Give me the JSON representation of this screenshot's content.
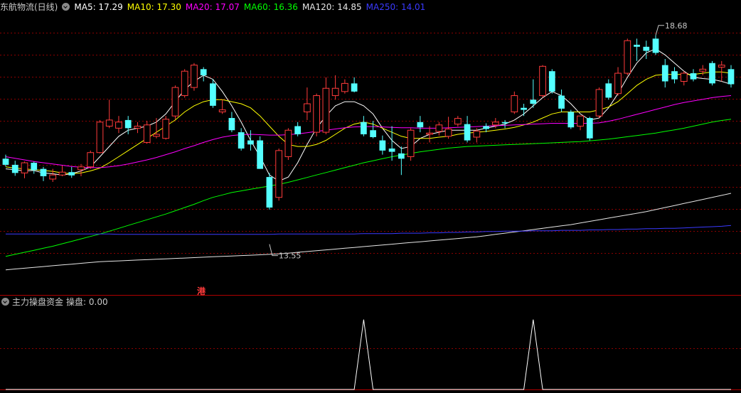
{
  "main_legend": {
    "title": "东航物流(日线)",
    "ma": [
      {
        "label": "MA5: 17.29",
        "color": "#ffffff"
      },
      {
        "label": "MA10: 17.30",
        "color": "#ffff00"
      },
      {
        "label": "MA20: 17.07",
        "color": "#ff00ff"
      },
      {
        "label": "MA60: 16.36",
        "color": "#00ff00"
      },
      {
        "label": "MA120: 14.85",
        "color": "#e6e6e6"
      },
      {
        "label": "MA250: 14.01",
        "color": "#3a3aff"
      }
    ]
  },
  "sub_legend": {
    "title": "主力操盘资金",
    "value_label": "操盘: 0.00"
  },
  "marker": {
    "text": "港",
    "color": "#ff3b3b"
  },
  "colors": {
    "up": "#ff3b3b",
    "down": "#54ffff",
    "grid": "#8b0000",
    "background": "#000000"
  },
  "chart_data": [
    {
      "type": "candlestick",
      "title": "东航物流(日线)",
      "ylim": [
        12.6,
        19.2
      ],
      "annotations": [
        {
          "label": "18.68",
          "type": "max_high",
          "value": 18.68
        },
        {
          "label": "13.55",
          "type": "min_low",
          "value": 13.55
        }
      ],
      "ohlc": [
        [
          15.65,
          15.75,
          15.46,
          15.5
        ],
        [
          15.5,
          15.6,
          15.23,
          15.3
        ],
        [
          15.3,
          15.58,
          15.17,
          15.55
        ],
        [
          15.55,
          15.58,
          15.28,
          15.37
        ],
        [
          15.4,
          15.45,
          15.1,
          15.22
        ],
        [
          15.15,
          15.4,
          15.08,
          15.25
        ],
        [
          15.25,
          15.48,
          15.22,
          15.32
        ],
        [
          15.32,
          15.45,
          15.18,
          15.24
        ],
        [
          15.38,
          15.52,
          15.22,
          15.45
        ],
        [
          15.45,
          15.85,
          15.4,
          15.8
        ],
        [
          15.8,
          16.6,
          15.78,
          16.55
        ],
        [
          16.45,
          17.1,
          16.4,
          16.6
        ],
        [
          16.4,
          16.7,
          16.28,
          16.55
        ],
        [
          16.6,
          16.7,
          16.25,
          16.4
        ],
        [
          16.4,
          16.55,
          16.28,
          16.45
        ],
        [
          16.05,
          16.58,
          16.02,
          16.48
        ],
        [
          16.2,
          16.65,
          16.15,
          16.25
        ],
        [
          16.15,
          16.7,
          16.12,
          16.62
        ],
        [
          16.7,
          17.45,
          16.62,
          17.4
        ],
        [
          17.2,
          17.85,
          17.15,
          17.8
        ],
        [
          17.4,
          18.0,
          17.32,
          17.95
        ],
        [
          17.85,
          17.9,
          17.55,
          17.7
        ],
        [
          17.5,
          17.6,
          16.9,
          16.95
        ],
        [
          16.8,
          17.1,
          16.75,
          16.85
        ],
        [
          16.65,
          16.8,
          16.3,
          16.35
        ],
        [
          16.3,
          16.4,
          15.85,
          15.9
        ],
        [
          16.1,
          16.35,
          15.85,
          16.0
        ],
        [
          16.1,
          16.2,
          15.4,
          15.4
        ],
        [
          15.2,
          15.3,
          14.4,
          14.45
        ],
        [
          14.7,
          15.9,
          14.62,
          15.85
        ],
        [
          15.7,
          16.4,
          15.62,
          16.35
        ],
        [
          16.45,
          16.55,
          16.2,
          16.25
        ],
        [
          16.8,
          17.4,
          16.6,
          17.0
        ],
        [
          16.3,
          17.25,
          16.2,
          17.2
        ],
        [
          16.3,
          17.65,
          16.25,
          17.38
        ],
        [
          17.2,
          17.7,
          17.1,
          17.38
        ],
        [
          17.3,
          17.6,
          17.25,
          17.5
        ],
        [
          17.5,
          17.65,
          17.28,
          17.3
        ],
        [
          16.55,
          16.7,
          16.2,
          16.25
        ],
        [
          16.35,
          16.58,
          16.15,
          16.18
        ],
        [
          16.1,
          16.22,
          15.75,
          15.85
        ],
        [
          15.9,
          16.45,
          15.6,
          15.82
        ],
        [
          15.78,
          15.95,
          15.25,
          15.65
        ],
        [
          15.7,
          16.4,
          15.6,
          16.35
        ],
        [
          16.55,
          16.7,
          16.3,
          16.42
        ],
        [
          16.25,
          16.45,
          16.05,
          16.28
        ],
        [
          16.32,
          16.55,
          16.22,
          16.48
        ],
        [
          16.2,
          16.68,
          16.14,
          16.38
        ],
        [
          16.5,
          16.7,
          16.44,
          16.64
        ],
        [
          16.5,
          16.7,
          16.05,
          16.1
        ],
        [
          16.18,
          16.4,
          16.05,
          16.33
        ],
        [
          16.45,
          16.52,
          16.3,
          16.38
        ],
        [
          16.48,
          16.65,
          16.4,
          16.55
        ],
        [
          16.55,
          16.6,
          16.4,
          16.52
        ],
        [
          16.8,
          17.3,
          16.75,
          17.2
        ],
        [
          16.9,
          17.0,
          16.7,
          16.85
        ],
        [
          17.1,
          17.6,
          16.9,
          17.0
        ],
        [
          17.2,
          17.95,
          17.15,
          17.92
        ],
        [
          17.8,
          17.85,
          17.25,
          17.3
        ],
        [
          17.2,
          17.35,
          16.8,
          16.88
        ],
        [
          16.8,
          16.85,
          16.38,
          16.42
        ],
        [
          16.45,
          16.7,
          16.35,
          16.7
        ],
        [
          16.65,
          16.68,
          16.1,
          16.15
        ],
        [
          16.7,
          17.4,
          16.65,
          17.35
        ],
        [
          17.5,
          17.6,
          17.1,
          17.15
        ],
        [
          17.25,
          17.9,
          17.2,
          17.75
        ],
        [
          17.75,
          18.6,
          17.7,
          18.55
        ],
        [
          18.45,
          18.6,
          18.05,
          18.4
        ],
        [
          18.4,
          18.55,
          18.1,
          18.3
        ],
        [
          18.6,
          18.68,
          18.2,
          18.25
        ],
        [
          17.95,
          18.1,
          17.4,
          17.55
        ],
        [
          17.8,
          17.9,
          17.5,
          17.6
        ],
        [
          17.55,
          17.8,
          17.45,
          17.75
        ],
        [
          17.75,
          17.85,
          17.55,
          17.6
        ],
        [
          17.8,
          17.95,
          17.7,
          17.85
        ],
        [
          18.0,
          18.05,
          17.45,
          17.5
        ],
        [
          17.9,
          18.05,
          17.55,
          17.95
        ],
        [
          17.85,
          17.95,
          17.4,
          17.48
        ]
      ],
      "series": [
        {
          "name": "MA5",
          "color": "#ffffff",
          "values": [
            15.4,
            15.38,
            15.35,
            15.36,
            15.3,
            15.28,
            15.25,
            15.28,
            15.35,
            15.45,
            15.7,
            15.95,
            16.2,
            16.35,
            16.4,
            16.45,
            16.55,
            16.75,
            17.05,
            17.35,
            17.55,
            17.7,
            17.6,
            17.3,
            16.95,
            16.55,
            16.1,
            15.7,
            15.25,
            15.1,
            15.2,
            15.55,
            16.0,
            16.4,
            16.7,
            16.95,
            17.05,
            17.05,
            16.95,
            16.75,
            16.4,
            16.1,
            15.9,
            15.95,
            16.15,
            16.25,
            16.3,
            16.35,
            16.35,
            16.35,
            16.35,
            16.4,
            16.45,
            16.5,
            16.6,
            16.75,
            16.95,
            17.15,
            17.3,
            17.2,
            17.0,
            16.75,
            16.6,
            16.65,
            16.9,
            17.25,
            17.65,
            18.0,
            18.25,
            18.35,
            18.2,
            18.0,
            17.8,
            17.65,
            17.62,
            17.6,
            17.55,
            17.48
          ]
        },
        {
          "name": "MA10",
          "color": "#ffff00",
          "values": [
            15.45,
            15.42,
            15.4,
            15.38,
            15.36,
            15.34,
            15.3,
            15.28,
            15.3,
            15.35,
            15.42,
            15.55,
            15.7,
            15.85,
            16.0,
            16.15,
            16.3,
            16.45,
            16.6,
            16.8,
            16.95,
            17.05,
            17.1,
            17.1,
            17.05,
            17.0,
            16.9,
            16.7,
            16.45,
            16.2,
            16.0,
            15.95,
            15.95,
            16.0,
            16.1,
            16.25,
            16.4,
            16.5,
            16.55,
            16.5,
            16.4,
            16.3,
            16.2,
            16.15,
            16.15,
            16.15,
            16.18,
            16.2,
            16.25,
            16.28,
            16.3,
            16.32,
            16.35,
            16.38,
            16.42,
            16.48,
            16.55,
            16.65,
            16.75,
            16.8,
            16.8,
            16.8,
            16.8,
            16.85,
            16.92,
            17.05,
            17.25,
            17.45,
            17.6,
            17.7,
            17.72,
            17.72,
            17.72,
            17.72,
            17.75,
            17.78,
            17.78,
            17.75
          ]
        },
        {
          "name": "MA20",
          "color": "#ff00ff",
          "values": [
            15.7,
            15.66,
            15.62,
            15.58,
            15.55,
            15.52,
            15.49,
            15.46,
            15.44,
            15.43,
            15.43,
            15.45,
            15.48,
            15.52,
            15.57,
            15.62,
            15.68,
            15.75,
            15.82,
            15.9,
            15.97,
            16.05,
            16.12,
            16.18,
            16.22,
            16.24,
            16.25,
            16.24,
            16.23,
            16.23,
            16.24,
            16.26,
            16.29,
            16.32,
            16.35,
            16.38,
            16.41,
            16.43,
            16.44,
            16.44,
            16.43,
            16.42,
            16.41,
            16.41,
            16.4,
            16.4,
            16.4,
            16.41,
            16.42,
            16.43,
            16.44,
            16.45,
            16.46,
            16.47,
            16.48,
            16.49,
            16.5,
            16.51,
            16.52,
            16.52,
            16.52,
            16.52,
            16.52,
            16.53,
            16.57,
            16.62,
            16.68,
            16.74,
            16.8,
            16.86,
            16.92,
            16.98,
            17.03,
            17.07,
            17.11,
            17.15,
            17.18,
            17.2
          ]
        },
        {
          "name": "MA60",
          "color": "#00ff00",
          "values": [
            13.25,
            13.3,
            13.35,
            13.4,
            13.45,
            13.5,
            13.56,
            13.62,
            13.68,
            13.74,
            13.8,
            13.87,
            13.94,
            14.01,
            14.08,
            14.15,
            14.22,
            14.29,
            14.37,
            14.45,
            14.53,
            14.62,
            14.7,
            14.76,
            14.82,
            14.86,
            14.9,
            14.94,
            14.98,
            15.02,
            15.07,
            15.13,
            15.19,
            15.25,
            15.31,
            15.37,
            15.43,
            15.49,
            15.55,
            15.6,
            15.65,
            15.7,
            15.74,
            15.78,
            15.82,
            15.85,
            15.88,
            15.91,
            15.93,
            15.95,
            15.96,
            15.97,
            15.98,
            15.99,
            16.0,
            16.01,
            16.02,
            16.03,
            16.04,
            16.05,
            16.06,
            16.07,
            16.09,
            16.11,
            16.13,
            16.16,
            16.19,
            16.22,
            16.25,
            16.28,
            16.32,
            16.36,
            16.4,
            16.45,
            16.5,
            16.55,
            16.59,
            16.62
          ]
        },
        {
          "name": "MA120",
          "color": "#e6e6e6",
          "values": [
            12.92,
            12.94,
            12.96,
            12.98,
            13.0,
            13.02,
            13.04,
            13.06,
            13.08,
            13.1,
            13.12,
            13.13,
            13.14,
            13.15,
            13.16,
            13.17,
            13.18,
            13.19,
            13.2,
            13.21,
            13.22,
            13.23,
            13.24,
            13.25,
            13.26,
            13.27,
            13.28,
            13.29,
            13.3,
            13.31,
            13.33,
            13.35,
            13.37,
            13.39,
            13.41,
            13.43,
            13.45,
            13.47,
            13.49,
            13.51,
            13.53,
            13.55,
            13.57,
            13.59,
            13.61,
            13.63,
            13.65,
            13.67,
            13.69,
            13.71,
            13.73,
            13.76,
            13.79,
            13.82,
            13.85,
            13.88,
            13.91,
            13.94,
            13.97,
            14.0,
            14.03,
            14.07,
            14.11,
            14.15,
            14.19,
            14.23,
            14.27,
            14.31,
            14.35,
            14.4,
            14.45,
            14.5,
            14.55,
            14.6,
            14.65,
            14.7,
            14.75,
            14.8
          ]
        },
        {
          "name": "MA250",
          "color": "#3a3aff",
          "values": [
            13.8,
            13.8,
            13.8,
            13.8,
            13.8,
            13.8,
            13.8,
            13.8,
            13.8,
            13.8,
            13.8,
            13.8,
            13.79,
            13.79,
            13.79,
            13.79,
            13.79,
            13.79,
            13.79,
            13.79,
            13.79,
            13.79,
            13.79,
            13.79,
            13.79,
            13.79,
            13.79,
            13.79,
            13.79,
            13.8,
            13.8,
            13.8,
            13.8,
            13.8,
            13.8,
            13.8,
            13.8,
            13.8,
            13.81,
            13.81,
            13.81,
            13.81,
            13.82,
            13.82,
            13.82,
            13.83,
            13.83,
            13.84,
            13.84,
            13.85,
            13.85,
            13.86,
            13.86,
            13.87,
            13.87,
            13.87,
            13.88,
            13.88,
            13.88,
            13.89,
            13.89,
            13.89,
            13.9,
            13.9,
            13.91,
            13.91,
            13.92,
            13.92,
            13.93,
            13.93,
            13.94,
            13.94,
            13.95,
            13.96,
            13.97,
            13.98,
            13.99,
            14.01
          ]
        }
      ]
    },
    {
      "type": "line",
      "title": "主力操盘资金",
      "series": [
        {
          "name": "操盘",
          "color": "#ffffff",
          "values": [
            0,
            0,
            0,
            0,
            0,
            0,
            0,
            0,
            0,
            0,
            0,
            0,
            0,
            0,
            0,
            0,
            0,
            0,
            0,
            0,
            0,
            0,
            0,
            0,
            0,
            0,
            0,
            0,
            0,
            0,
            0,
            0,
            0,
            0,
            0,
            0,
            0,
            0,
            1,
            0,
            0,
            0,
            0,
            0,
            0,
            0,
            0,
            0,
            0,
            0,
            0,
            0,
            0,
            0,
            0,
            0,
            1,
            0,
            0,
            0,
            0,
            0,
            0,
            0,
            0,
            0,
            0,
            0,
            0,
            0,
            0,
            0,
            0,
            0,
            0,
            0,
            0,
            0
          ]
        }
      ],
      "ylim": [
        0,
        1.15
      ]
    }
  ]
}
